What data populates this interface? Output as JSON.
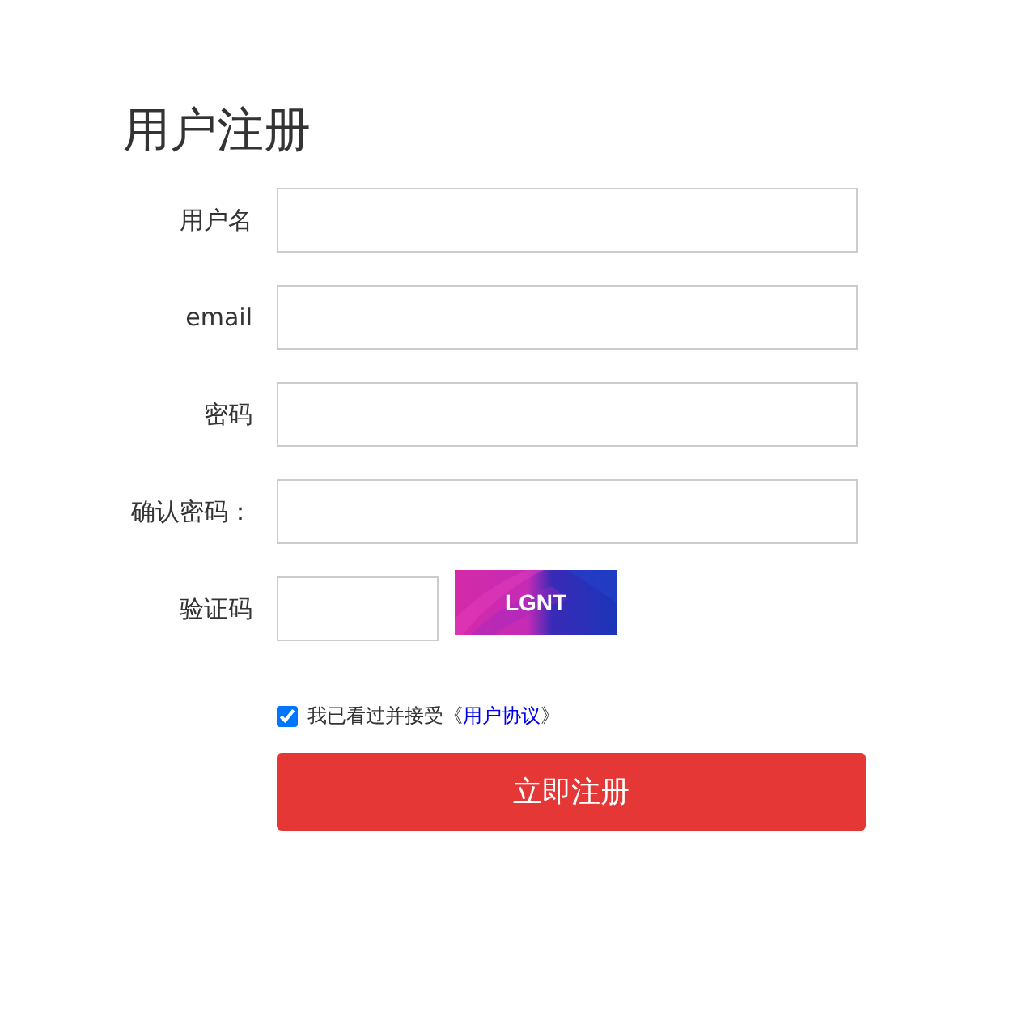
{
  "title": "用户注册",
  "fields": [
    {
      "label": "用户名",
      "kind": "text"
    },
    {
      "label": "email",
      "kind": "text"
    },
    {
      "label": "密码",
      "kind": "password"
    },
    {
      "label": "确认密码：",
      "kind": "password"
    },
    {
      "label": "验证码",
      "kind": "captcha"
    }
  ],
  "captcha": {
    "text": "LGNT"
  },
  "agreement": {
    "checked": true,
    "before": "我已看过并接受《",
    "link": "用户协议",
    "after": "》"
  },
  "submit": "立即注册"
}
